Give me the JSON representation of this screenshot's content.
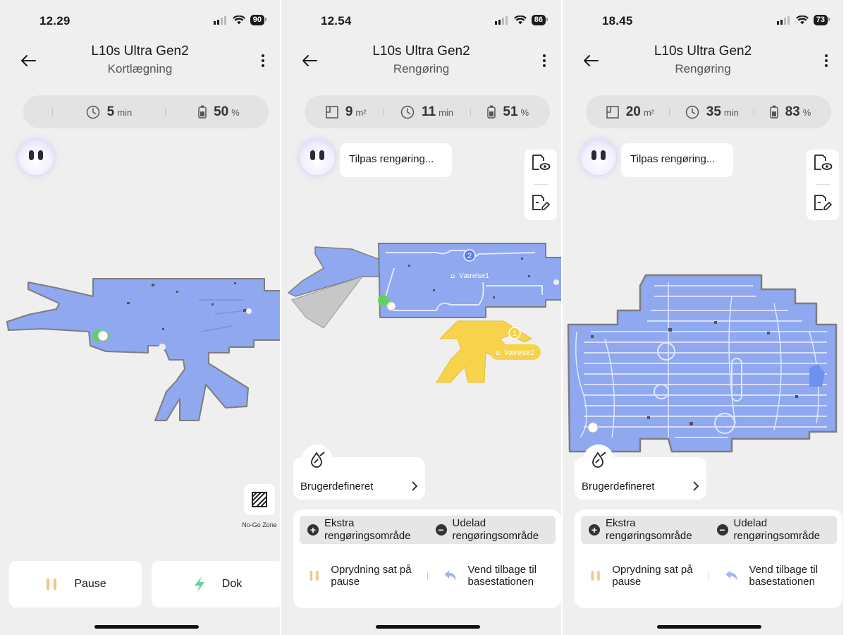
{
  "screens": [
    {
      "status": {
        "time": "12.29",
        "battery": "90"
      },
      "header": {
        "title": "L10s Ultra Gen2",
        "subtitle": "Kortlægning"
      },
      "stats": {
        "time_value": "5",
        "time_unit": "min",
        "battery_value": "50",
        "battery_unit": "%"
      },
      "no_go_zone": {
        "label": "No-Go Zone"
      },
      "actions": {
        "pause_label": "Pause",
        "dock_label": "Dok"
      }
    },
    {
      "status": {
        "time": "12.54",
        "battery": "86"
      },
      "header": {
        "title": "L10s Ultra Gen2",
        "subtitle": "Rengøring"
      },
      "stats": {
        "area_value": "9",
        "area_unit": "m²",
        "time_value": "11",
        "time_unit": "min",
        "battery_value": "51",
        "battery_unit": "%"
      },
      "assistant": {
        "bubble": "Tilpas rengøring..."
      },
      "map": {
        "rooms": [
          {
            "number": "2",
            "name": "Værelse1"
          },
          {
            "number": "1",
            "name": "Værelse2"
          }
        ]
      },
      "mode": {
        "label": "Brugerdefineret"
      },
      "panel": {
        "extra_area": "Ekstra rengøringsområde",
        "exclude_area": "Udelad rengøringsområde",
        "paused": "Oprydning sat på pause",
        "return": "Vend tilbage til basestationen"
      }
    },
    {
      "status": {
        "time": "18.45",
        "battery": "73"
      },
      "header": {
        "title": "L10s Ultra Gen2",
        "subtitle": "Rengøring"
      },
      "stats": {
        "area_value": "20",
        "area_unit": "m²",
        "time_value": "35",
        "time_unit": "min",
        "battery_value": "83",
        "battery_unit": "%"
      },
      "assistant": {
        "bubble": "Tilpas rengøring..."
      },
      "mode": {
        "label": "Brugerdefineret"
      },
      "panel": {
        "extra_area": "Ekstra rengøringsområde",
        "exclude_area": "Udelad rengøringsområde",
        "paused": "Oprydning sat på pause",
        "return": "Vend tilbage til basestationen"
      }
    }
  ],
  "colors": {
    "map_blue": "#8fa8f0",
    "map_edge": "#7d7d7d",
    "room_yellow": "#f6d34a",
    "robot_green": "#5fd15f",
    "path_light": "#dfe8ff"
  },
  "icons": [
    "back-arrow-icon",
    "more-vertical-icon",
    "clock-icon",
    "battery-icon",
    "area-icon",
    "map-view-icon",
    "map-edit-icon",
    "no-go-zone-icon",
    "pause-icon",
    "dock-bolt-icon",
    "water-drop-icon",
    "chevron-right-icon",
    "plus-circle-icon",
    "minus-circle-icon",
    "return-arrow-icon",
    "home-icon"
  ]
}
